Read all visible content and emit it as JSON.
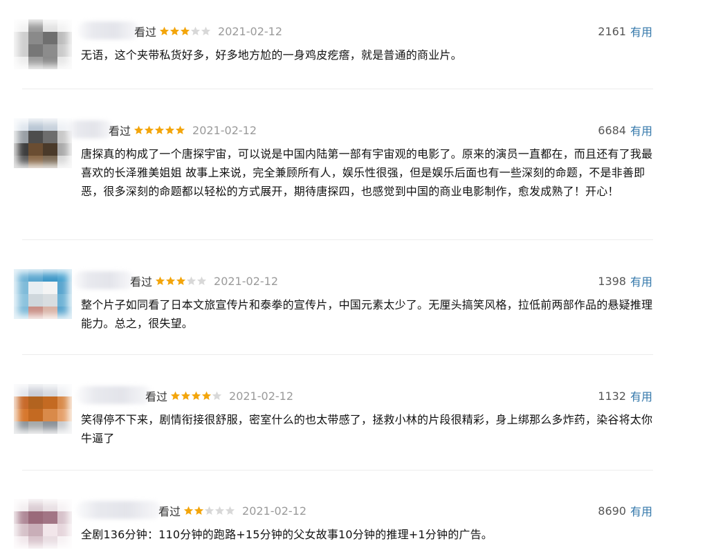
{
  "colors": {
    "star_filled": "#f3a50b",
    "star_empty": "#d8d8d8",
    "link": "#3377aa",
    "date": "#9a9a9a"
  },
  "comments": [
    {
      "watched_label": "看过",
      "rating": 3,
      "date": "2021-02-12",
      "votes": "2161",
      "useful_label": "有用",
      "text": "无语，这个夹带私货好多，好多地方尬的一身鸡皮疙瘩，就是普通的商业片。",
      "avatar_colors": [
        "#f2f2f2",
        "#9a9a9a",
        "#e2e2e2",
        "#f2f2f2",
        "#cfcfcf",
        "#8a8a8a",
        "#6f6f6f",
        "#bdbdbd",
        "#cfcfcf",
        "#777777",
        "#8c8c8c",
        "#cacaca",
        "#ededed",
        "#9c9c9c",
        "#8a8a8a",
        "#e7e7e7"
      ]
    },
    {
      "watched_label": "看过",
      "rating": 5,
      "date": "2021-02-12",
      "votes": "6684",
      "useful_label": "有用",
      "text": "唐探真的构成了一个唐探宇宙，可以说是中国内陆第一部有宇宙观的电影了。原来的演员一直都在，而且还有了我最喜欢的长泽雅美姐姐 故事上来说，完全兼顾所有人，娱乐性很强，但是娱乐后面也有一些深刻的命题，不是非善即恶，很多深刻的命题都以轻松的方式展开，期待唐探四，也感觉到中国的商业电影制作，愈发成熟了！开心！",
      "avatar_colors": [
        "#dfe6ee",
        "#b9c6d4",
        "#c7d1dc",
        "#eef1f5",
        "#9aa0a6",
        "#4d4d4d",
        "#6d6d6d",
        "#c8c8c8",
        "#3e3e3e",
        "#6a4d32",
        "#4a3a2a",
        "#a9a9a9",
        "#5c5c5c",
        "#8a6a4a",
        "#7b6a55",
        "#d8d8d8"
      ]
    },
    {
      "watched_label": "看过",
      "rating": 3,
      "date": "2021-02-12",
      "votes": "1398",
      "useful_label": "有用",
      "text": "整个片子如同看了日本文旅宣传片和泰拳的宣传片，中国元素太少了。无厘头搞笑风格，拉低前两部作品的悬疑推理能力。总之，很失望。",
      "avatar_colors": [
        "#6fb3d6",
        "#5aa6cf",
        "#3e98c8",
        "#4aa3d0",
        "#7fbbd9",
        "#e8eef2",
        "#f4f4f4",
        "#5aa6cf",
        "#8cc3de",
        "#cfd7dc",
        "#d8dde0",
        "#6fb3d6",
        "#7fbbd9",
        "#c98f86",
        "#d9b3a6",
        "#5aa6cf"
      ]
    },
    {
      "watched_label": "看过",
      "rating": 4,
      "date": "2021-02-12",
      "votes": "1132",
      "useful_label": "有用",
      "text": "笑得停不下来，剧情衔接很舒服，密室什么的也太带感了，拯救小林的片段很精彩，身上绑那么多炸药，染谷将太你牛逼了",
      "avatar_colors": [
        "#e4e6ec",
        "#c9ccd6",
        "#d6d9e0",
        "#eceef2",
        "#c86a2a",
        "#b2631f",
        "#c46a22",
        "#d98a4a",
        "#d7782e",
        "#c46a22",
        "#d98a4a",
        "#e5a06a",
        "#8f969c",
        "#a6a9ab",
        "#8c9299",
        "#c9ccd0"
      ]
    },
    {
      "watched_label": "看过",
      "rating": 2,
      "date": "2021-02-12",
      "votes": "8690",
      "useful_label": "有用",
      "text": "全剧136分钟：110分钟的跑路+15分钟的父女故事10分钟的推理+1分钟的广告。",
      "avatar_colors": [
        "#f3eef0",
        "#dbcdd3",
        "#e9e0e4",
        "#f6f2f4",
        "#b08a98",
        "#9a6a7a",
        "#a27585",
        "#d7c2ca",
        "#d6c2c9",
        "#c9aeb8",
        "#f2e6ea",
        "#e6d6dc",
        "#f1e7eb",
        "#d9c4cc",
        "#e9dde2",
        "#f7f2f4"
      ]
    }
  ]
}
